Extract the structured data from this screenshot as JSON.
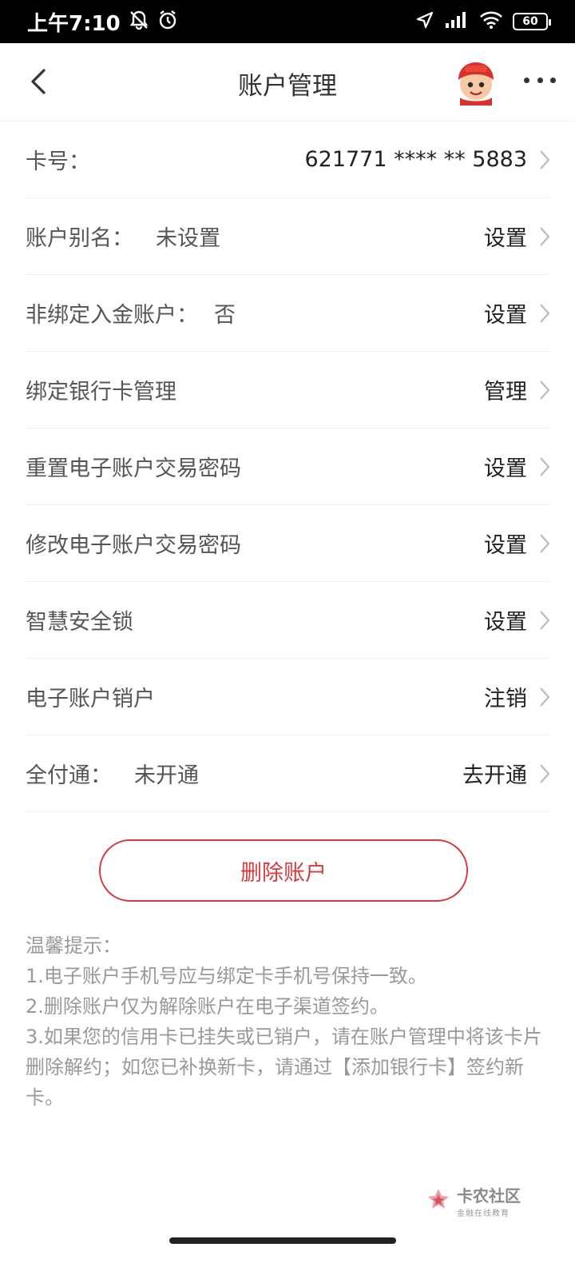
{
  "status_bar": {
    "time": "上午7:10",
    "battery": "60",
    "icons": [
      "muted-bell-icon",
      "alarm-icon",
      "location-icon",
      "signal-icon",
      "wifi-icon",
      "battery-icon"
    ]
  },
  "header": {
    "title": "账户管理",
    "back_icon": "chevron-left-icon",
    "avatar_icon": "mascot-avatar",
    "more_icon": "more-dots-icon"
  },
  "rows": [
    {
      "label": "卡号：",
      "sub": "",
      "action": "621771 **** ** 5883"
    },
    {
      "label": "账户别名：",
      "sub": "未设置",
      "action": "设置"
    },
    {
      "label": "非绑定入金账户：",
      "sub": "否",
      "action": "设置"
    },
    {
      "label": "绑定银行卡管理",
      "sub": "",
      "action": "管理"
    },
    {
      "label": "重置电子账户交易密码",
      "sub": "",
      "action": "设置"
    },
    {
      "label": "修改电子账户交易密码",
      "sub": "",
      "action": "设置"
    },
    {
      "label": "智慧安全锁",
      "sub": "",
      "action": "设置"
    },
    {
      "label": "电子账户销户",
      "sub": "",
      "action": "注销"
    },
    {
      "label": "全付通：",
      "sub": "未开通",
      "action": "去开通"
    }
  ],
  "delete_button": {
    "label": "删除账户"
  },
  "tips": {
    "title": "温馨提示：",
    "items": [
      "1.电子账户手机号应与绑定卡手机号保持一致。",
      "2.删除账户仅为解除账户在电子渠道签约。",
      "3.如果您的信用卡已挂失或已销户，请在账户管理中将该卡片删除解约；如您已补换新卡，请通过【添加银行卡】签约新卡。"
    ]
  },
  "watermark": {
    "title": "卡农社区",
    "subtitle": "金融在线教育"
  },
  "colors": {
    "accent": "#d53a3f",
    "text": "#333333",
    "muted": "#999999"
  }
}
